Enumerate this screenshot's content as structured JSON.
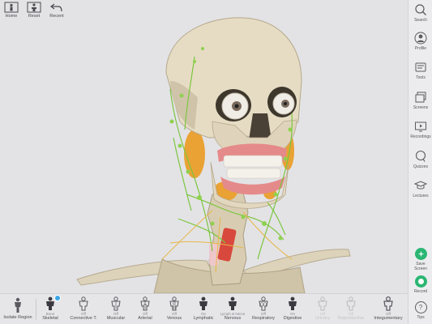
{
  "toolbar": {
    "home_label": "Home",
    "reset_label": "Reset",
    "recent_label": "Recent"
  },
  "sidebar": {
    "items": [
      {
        "label": "Search",
        "icon": "search-icon"
      },
      {
        "label": "Profile",
        "icon": "profile-icon"
      },
      {
        "label": "Tools",
        "icon": "tools-icon"
      },
      {
        "label": "Screens",
        "icon": "screens-icon"
      },
      {
        "label": "Recordings",
        "icon": "recordings-icon"
      },
      {
        "label": "Quizzes",
        "icon": "quizzes-icon"
      },
      {
        "label": "Lectures",
        "icon": "lectures-icon"
      },
      {
        "label": "Save Screen",
        "icon": "save-screen-icon"
      },
      {
        "label": "Record",
        "icon": "record-icon"
      },
      {
        "label": "Tips",
        "icon": "tips-icon"
      }
    ],
    "accent_color": "#2bb673"
  },
  "systems_bar": {
    "isolate_label": "Isolate Region",
    "systems": [
      {
        "state": "Bone",
        "name": "Skeletal",
        "badge": true
      },
      {
        "state": "Off",
        "name": "Connective T."
      },
      {
        "state": "Off",
        "name": "Muscular"
      },
      {
        "state": "Off",
        "name": "Arterial"
      },
      {
        "state": "Off",
        "name": "Venous"
      },
      {
        "state": "On",
        "name": "Lymphatic"
      },
      {
        "state": "Lymph & Nerve",
        "name": "Nervous"
      },
      {
        "state": "Off",
        "name": "Respiratory"
      },
      {
        "state": "On",
        "name": "Digestive"
      },
      {
        "state": "Off",
        "name": "Urinary"
      },
      {
        "state": "Off",
        "name": "Reproductive"
      },
      {
        "state": "Off",
        "name": "Integumentary"
      }
    ],
    "badge_color": "#3aa6e8"
  },
  "model": {
    "bone_color": "#e6dcc4",
    "lymph_color": "#8fd14f",
    "gland_color": "#e9a233",
    "gum_color": "#e58a8a"
  }
}
